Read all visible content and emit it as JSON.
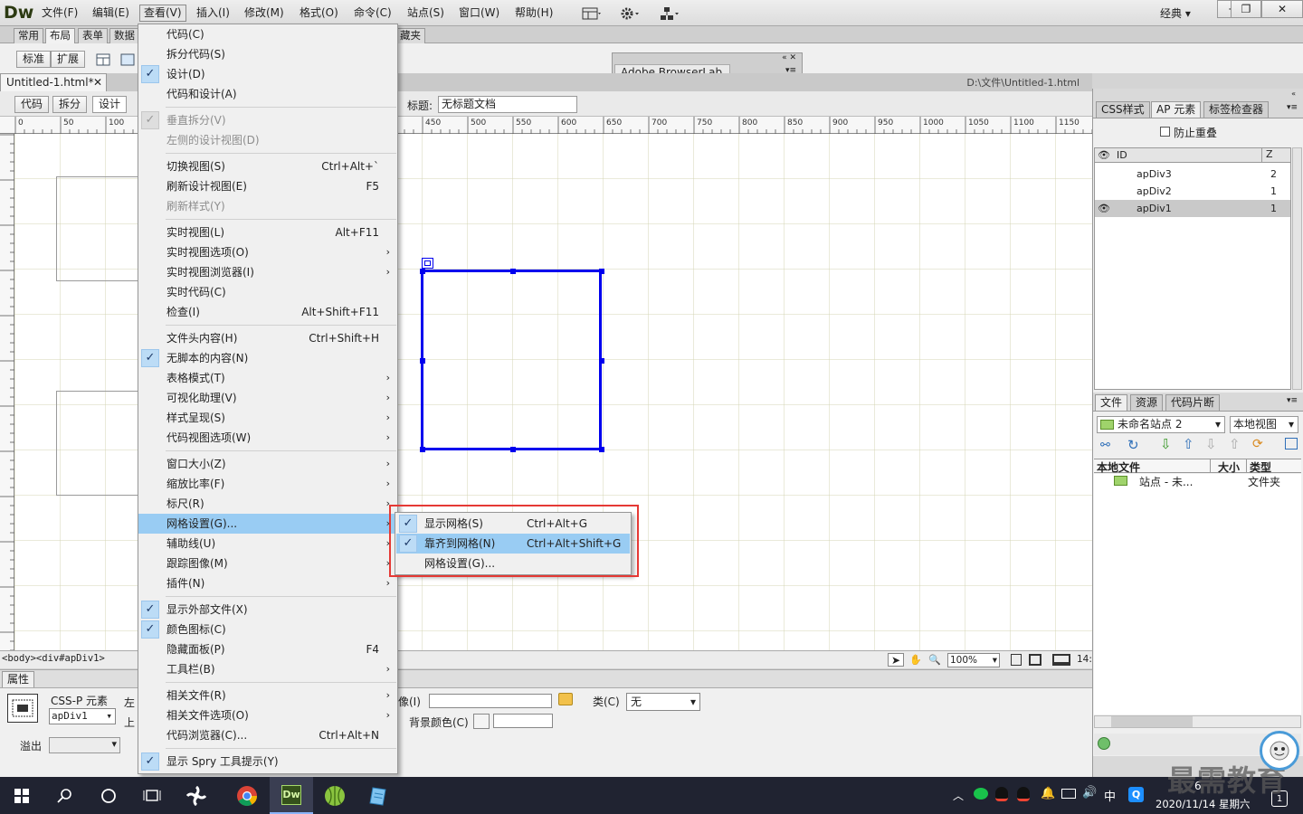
{
  "app": {
    "logo": "Dw"
  },
  "menubar": {
    "items": [
      "文件(F)",
      "编辑(E)",
      "查看(V)",
      "插入(I)",
      "修改(M)",
      "格式(O)",
      "命令(C)",
      "站点(S)",
      "窗口(W)",
      "帮助(H)"
    ],
    "workspace": "经典",
    "icons": [
      "layout-icon",
      "gear-icon",
      "site-icon"
    ]
  },
  "insert_panel": {
    "tabs": [
      "常用",
      "布局",
      "表单",
      "数据",
      "藏夹"
    ],
    "buttons": [
      "标准",
      "扩展"
    ]
  },
  "browserlab": {
    "title": "Adobe BrowserLab"
  },
  "document": {
    "tab": "Untitled-1.html*",
    "path": "D:\\文件\\Untitled-1.html",
    "view_buttons": [
      "代码",
      "拆分",
      "设计"
    ],
    "title_label": "标题:",
    "title_value": "无标题文档"
  },
  "ruler": {
    "ticks": [
      "0",
      "50",
      "100",
      "450",
      "500",
      "550",
      "600",
      "650",
      "700",
      "750",
      "800",
      "850",
      "900",
      "950",
      "1000",
      "1050",
      "1100",
      "1150"
    ]
  },
  "statusbar": {
    "tags": "<body><div#apDiv1>",
    "zoom": "100%",
    "width_hint": "14:"
  },
  "properties": {
    "tab": "属性",
    "element_type": "CSS-P 元素",
    "id_value": "apDiv1",
    "left_label": "左",
    "top_label": "上",
    "overflow_label": "溢出",
    "bg_image_label": "像(I)",
    "class_label": "类(C)",
    "class_value": "无",
    "bg_color_label": "背景颜色(C)"
  },
  "ap_panel": {
    "tabs": [
      "CSS样式",
      "AP 元素",
      "标签检查器"
    ],
    "prevent_overlap": "防止重叠",
    "col_id": "ID",
    "col_z": "Z",
    "rows": [
      {
        "id": "apDiv3",
        "z": "2",
        "selected": false
      },
      {
        "id": "apDiv2",
        "z": "1",
        "selected": false
      },
      {
        "id": "apDiv1",
        "z": "1",
        "selected": true
      }
    ]
  },
  "files_panel": {
    "tabs": [
      "文件",
      "资源",
      "代码片断"
    ],
    "site": "未命名站点 2",
    "view": "本地视图",
    "col_local": "本地文件",
    "col_size": "大小",
    "col_type": "类型",
    "row_name": "站点 - 未...",
    "row_type": "文件夹"
  },
  "view_menu": {
    "items": [
      {
        "label": "代码(C)",
        "shortcut": "",
        "check": false,
        "disabled": false,
        "submenu": false
      },
      {
        "label": "拆分代码(S)",
        "shortcut": "",
        "check": false,
        "disabled": false,
        "submenu": false
      },
      {
        "label": "设计(D)",
        "shortcut": "",
        "check": true,
        "disabled": false,
        "submenu": false
      },
      {
        "label": "代码和设计(A)",
        "shortcut": "",
        "check": false,
        "disabled": false,
        "submenu": false
      },
      {
        "sep": true
      },
      {
        "label": "垂直拆分(V)",
        "shortcut": "",
        "check": true,
        "disabled": true,
        "submenu": false
      },
      {
        "label": "左侧的设计视图(D)",
        "shortcut": "",
        "check": false,
        "disabled": true,
        "submenu": false
      },
      {
        "sep": true
      },
      {
        "label": "切换视图(S)",
        "shortcut": "Ctrl+Alt+`",
        "check": false,
        "disabled": false,
        "submenu": false
      },
      {
        "label": "刷新设计视图(E)",
        "shortcut": "F5",
        "check": false,
        "disabled": false,
        "submenu": false
      },
      {
        "label": "刷新样式(Y)",
        "shortcut": "",
        "check": false,
        "disabled": true,
        "submenu": false
      },
      {
        "sep": true
      },
      {
        "label": "实时视图(L)",
        "shortcut": "Alt+F11",
        "check": false,
        "disabled": false,
        "submenu": false
      },
      {
        "label": "实时视图选项(O)",
        "shortcut": "",
        "check": false,
        "disabled": false,
        "submenu": true
      },
      {
        "label": "实时视图浏览器(I)",
        "shortcut": "",
        "check": false,
        "disabled": false,
        "submenu": true
      },
      {
        "label": "实时代码(C)",
        "shortcut": "",
        "check": false,
        "disabled": false,
        "submenu": false
      },
      {
        "label": "检查(I)",
        "shortcut": "Alt+Shift+F11",
        "check": false,
        "disabled": false,
        "submenu": false
      },
      {
        "sep": true
      },
      {
        "label": "文件头内容(H)",
        "shortcut": "Ctrl+Shift+H",
        "check": false,
        "disabled": false,
        "submenu": false
      },
      {
        "label": "无脚本的内容(N)",
        "shortcut": "",
        "check": true,
        "disabled": false,
        "submenu": false
      },
      {
        "label": "表格模式(T)",
        "shortcut": "",
        "check": false,
        "disabled": false,
        "submenu": true
      },
      {
        "label": "可视化助理(V)",
        "shortcut": "",
        "check": false,
        "disabled": false,
        "submenu": true
      },
      {
        "label": "样式呈现(S)",
        "shortcut": "",
        "check": false,
        "disabled": false,
        "submenu": true
      },
      {
        "label": "代码视图选项(W)",
        "shortcut": "",
        "check": false,
        "disabled": false,
        "submenu": true
      },
      {
        "sep": true
      },
      {
        "label": "窗口大小(Z)",
        "shortcut": "",
        "check": false,
        "disabled": false,
        "submenu": true
      },
      {
        "label": "缩放比率(F)",
        "shortcut": "",
        "check": false,
        "disabled": false,
        "submenu": true
      },
      {
        "label": "标尺(R)",
        "shortcut": "",
        "check": false,
        "disabled": false,
        "submenu": true
      },
      {
        "label": "网格设置(G)...",
        "shortcut": "",
        "check": false,
        "disabled": false,
        "submenu": true,
        "highlight": true
      },
      {
        "label": "辅助线(U)",
        "shortcut": "",
        "check": false,
        "disabled": false,
        "submenu": true
      },
      {
        "label": "跟踪图像(M)",
        "shortcut": "",
        "check": false,
        "disabled": false,
        "submenu": true
      },
      {
        "label": "插件(N)",
        "shortcut": "",
        "check": false,
        "disabled": false,
        "submenu": true
      },
      {
        "sep": true
      },
      {
        "label": "显示外部文件(X)",
        "shortcut": "",
        "check": true,
        "disabled": false,
        "submenu": false
      },
      {
        "label": "颜色图标(C)",
        "shortcut": "",
        "check": true,
        "disabled": false,
        "submenu": false
      },
      {
        "label": "隐藏面板(P)",
        "shortcut": "F4",
        "check": false,
        "disabled": false,
        "submenu": false
      },
      {
        "label": "工具栏(B)",
        "shortcut": "",
        "check": false,
        "disabled": false,
        "submenu": true
      },
      {
        "sep": true
      },
      {
        "label": "相关文件(R)",
        "shortcut": "",
        "check": false,
        "disabled": false,
        "submenu": true
      },
      {
        "label": "相关文件选项(O)",
        "shortcut": "",
        "check": false,
        "disabled": false,
        "submenu": true
      },
      {
        "label": "代码浏览器(C)...",
        "shortcut": "Ctrl+Alt+N",
        "check": false,
        "disabled": false,
        "submenu": false
      },
      {
        "sep": true
      },
      {
        "label": "显示 Spry 工具提示(Y)",
        "shortcut": "",
        "check": true,
        "disabled": false,
        "submenu": false
      }
    ]
  },
  "grid_submenu": {
    "items": [
      {
        "label": "显示网格(S)",
        "shortcut": "Ctrl+Alt+G",
        "check": true,
        "highlight": false
      },
      {
        "label": "靠齐到网格(N)",
        "shortcut": "Ctrl+Alt+Shift+G",
        "check": true,
        "highlight": true
      },
      {
        "label": "网格设置(G)...",
        "shortcut": "",
        "check": false,
        "highlight": false
      }
    ]
  },
  "taskbar": {
    "clock_time": "6",
    "clock_date": "2020/11/14 星期六",
    "ime": "中",
    "notify_count": "1",
    "apps": [
      "start-icon",
      "search-icon",
      "cortana-icon",
      "taskview-icon",
      "fan-icon",
      "chrome-icon",
      "dreamweaver-icon",
      "ball-icon",
      "notepad-icon"
    ]
  },
  "watermark": "最需教育",
  "colors": {
    "accent": "#99ccf3",
    "ap_border": "#0000ee",
    "grid": "#d4d6b4",
    "highlight_box": "#e53935"
  }
}
